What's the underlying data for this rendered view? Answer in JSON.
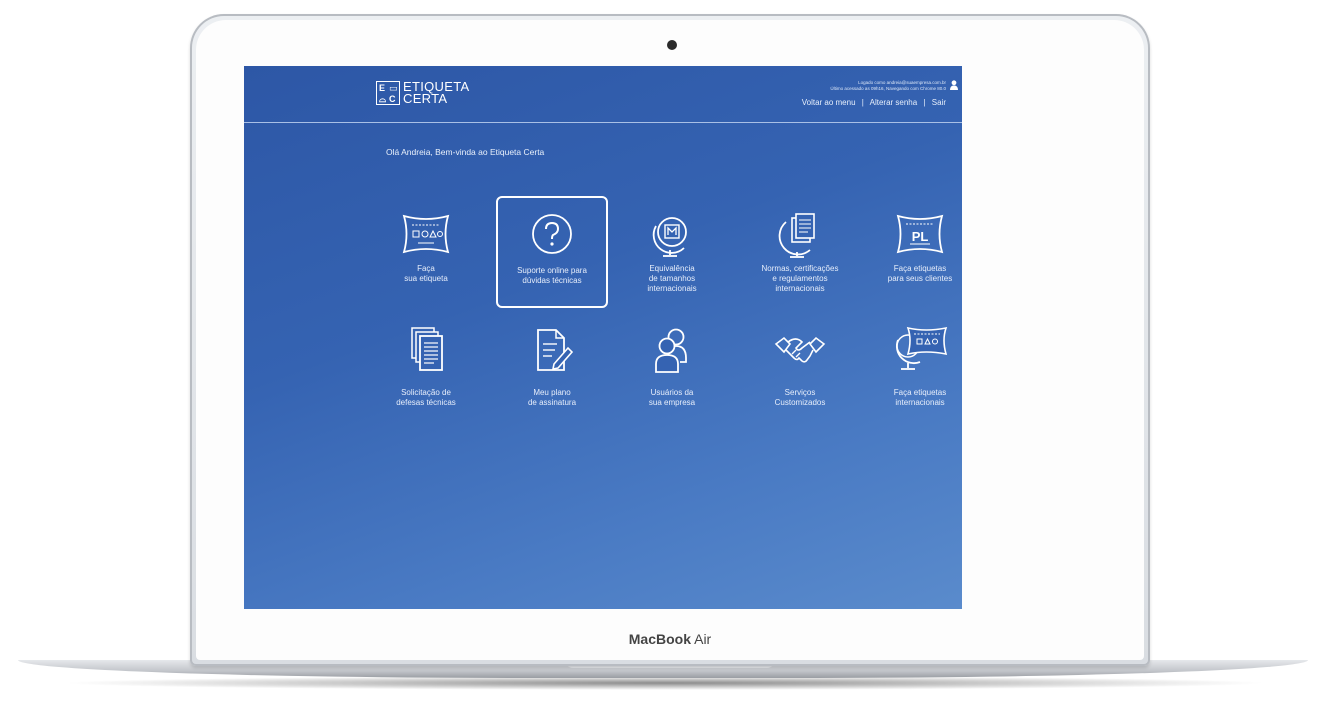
{
  "device": {
    "label_bold": "MacBook",
    "label_light": "Air"
  },
  "app": {
    "logo_line1": "ETIQUETA",
    "logo_line2": "CERTA",
    "login_text": "Logado como andreia@suaempresa.com.br",
    "login_subtext": "Último acessado as 09h16, Navegando com Chrome 80.0",
    "nav": [
      "Voltar ao menu",
      "Alterar senha",
      "Sair"
    ],
    "greeting": "Olá Andreia, Bem-vinda ao Etiqueta Certa"
  },
  "tiles": [
    {
      "label": "Faça\nsua etiqueta",
      "icon": "label-shapes-icon"
    },
    {
      "label": "Suporte online para\ndúvidas técnicas",
      "icon": "question-circle-icon",
      "selected": true
    },
    {
      "label": "Equivalência\nde tamanhos\ninternacionais",
      "icon": "globe-m-icon"
    },
    {
      "label": "Normas, certificações\ne regulamentos\ninternacionais",
      "icon": "globe-document-icon"
    },
    {
      "label": "Faça etiquetas\npara seus clientes",
      "icon": "pl-label-icon"
    },
    {
      "label": "Solicitação de\ndefesas técnicas",
      "icon": "documents-stack-icon"
    },
    {
      "label": "Meu plano\nde assinatura",
      "icon": "document-pen-icon"
    },
    {
      "label": "Usuários da\nsua empresa",
      "icon": "users-icon"
    },
    {
      "label": "Serviços\nCustomizados",
      "icon": "handshake-icon"
    },
    {
      "label": "Faça etiquetas\ninternacionais",
      "icon": "globe-label-icon"
    }
  ],
  "colors": {
    "screen_bg": "#3563b2",
    "text": "#e7eefb"
  }
}
